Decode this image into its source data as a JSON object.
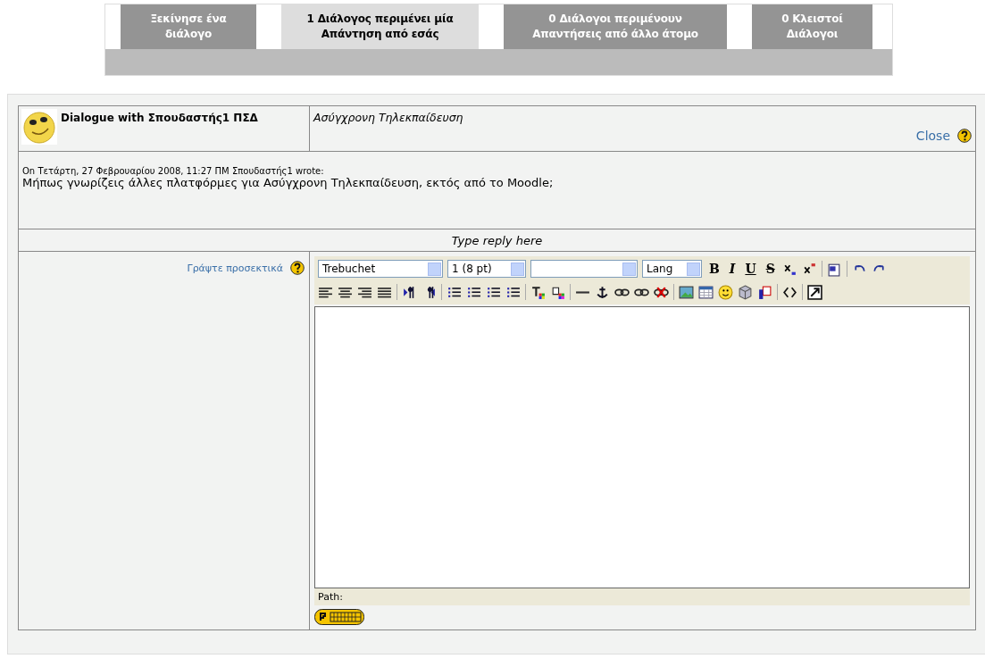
{
  "tabs": [
    {
      "lines": [
        "Ξεκίνησε ένα",
        "διάλογο"
      ],
      "selected": false
    },
    {
      "lines": [
        "1 Διάλογος περιμένει μία",
        "Απάντηση από εσάς"
      ],
      "selected": true
    },
    {
      "lines": [
        "0 Διάλογοι περιμένουν",
        "Απαντήσεις από άλλο άτομο"
      ],
      "selected": false
    },
    {
      "lines": [
        "0 Κλειστοί",
        "Διάλογοι"
      ],
      "selected": false
    }
  ],
  "dialogue": {
    "title": "Dialogue with Σπουδαστής1 ΠΣΔ",
    "subject": "Ασύγχρονη Τηλεκπαίδευση",
    "close": "Close"
  },
  "message": {
    "meta": "On Τετάρτη, 27 Φεβρουαρίου 2008, 11:27 ΠΜ Σπουδαστής1 wrote:",
    "body": "Μήπως γνωρίζεις άλλες πλατφόρμες για Ασύγχρονη Τηλεκπαίδευση, εκτός από το Moodle;"
  },
  "reply_header": "Type reply here",
  "reply_label": "Γράψτε προσεκτικά",
  "editor": {
    "font": "Trebuchet",
    "size": "1 (8 pt)",
    "lang": "Lang",
    "format_buttons": [
      "B",
      "I",
      "U",
      "S"
    ],
    "path_label": "Path:"
  }
}
